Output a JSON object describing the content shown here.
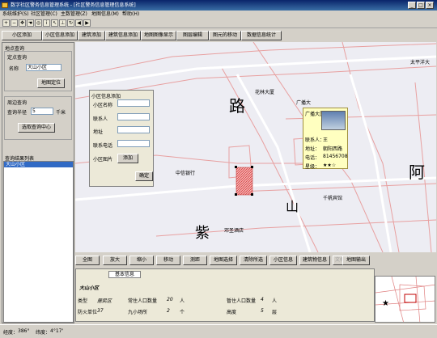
{
  "window": {
    "title": "数字社区警务信息管理系统 - [社区警务信息管理信息系统]"
  },
  "menu": [
    "系统维护(S)",
    "社区管理(C)",
    "主数管理(Z)",
    "地图信息(M)",
    "帮助(H)"
  ],
  "toolbar_icons": [
    "zoom-in",
    "zoom-out",
    "pan",
    "hand",
    "full-extent",
    "identify",
    "select",
    "measure",
    "refresh",
    "back",
    "forward"
  ],
  "toolbar_buttons": [
    "小区添加",
    "小区信息添加",
    "建筑添加",
    "建筑信息添加",
    "地图图像显示",
    "图层编辑",
    "图元的移动",
    "数据信息统计"
  ],
  "left": {
    "query_title": "地点查询",
    "sub_query": "定点查询",
    "name_label": "名称",
    "name_value": "大山小区",
    "locate_btn": "地图定位",
    "circle_query": "周边查询",
    "radius_label": "查询半径",
    "radius_value": "5",
    "radius_unit": "千米",
    "center_btn": "选取查询中心",
    "result_title": "查询结果列表",
    "result_item": "大山小区"
  },
  "map": {
    "labels": {
      "flower_tower": "花林大厦",
      "zhongxin_bank": "中信银行",
      "road1": "路",
      "road2": "山",
      "road3": "紫",
      "road4": "阿",
      "taiping": "太平洋大",
      "qianfan": "千帆宾馆",
      "dengsheng": "邓圣酒店",
      "guangbiao": "广播大"
    }
  },
  "dialog": {
    "title": "小区信息添加",
    "fields": [
      "小区名称",
      "联系人",
      "地址",
      "联系电话",
      "小区图片"
    ],
    "add_btn": "添加",
    "ok_btn": "确定"
  },
  "popup": {
    "title": "广播大厦",
    "contact_label": "联系人：",
    "contact_value": "王",
    "address_label": "地址：",
    "address_value": "朝阳西路",
    "phone_label": "电话：",
    "phone_value": "81456708",
    "level_label": "星级：",
    "level_value": "★★☆"
  },
  "map_buttons": [
    "全图",
    "放大",
    "缩小",
    "移动",
    "测距",
    "地图选择",
    "清除所选",
    "小区信息",
    "建筑物信息",
    "文档信息",
    "地图输出"
  ],
  "info": {
    "tab": "基本信息",
    "name": "大山小区",
    "type_label": "类型",
    "type_value": "居民区",
    "resident_label": "常住人口数量",
    "resident_value": "20",
    "resident_unit": "人",
    "temp_label": "暂住人口数量",
    "temp_value": "4",
    "temp_unit": "人",
    "fire_label": "防火单位",
    "fire_value": "37",
    "floors_label": "九小场所",
    "floors_value": "2",
    "floors_unit": "个",
    "height_label": "高度",
    "height_value": "5",
    "height_unit": "层"
  },
  "status": {
    "lon_label": "经度：",
    "lon_value": "386°",
    "lat_label": "纬度：",
    "lat_value": "4°17'"
  }
}
